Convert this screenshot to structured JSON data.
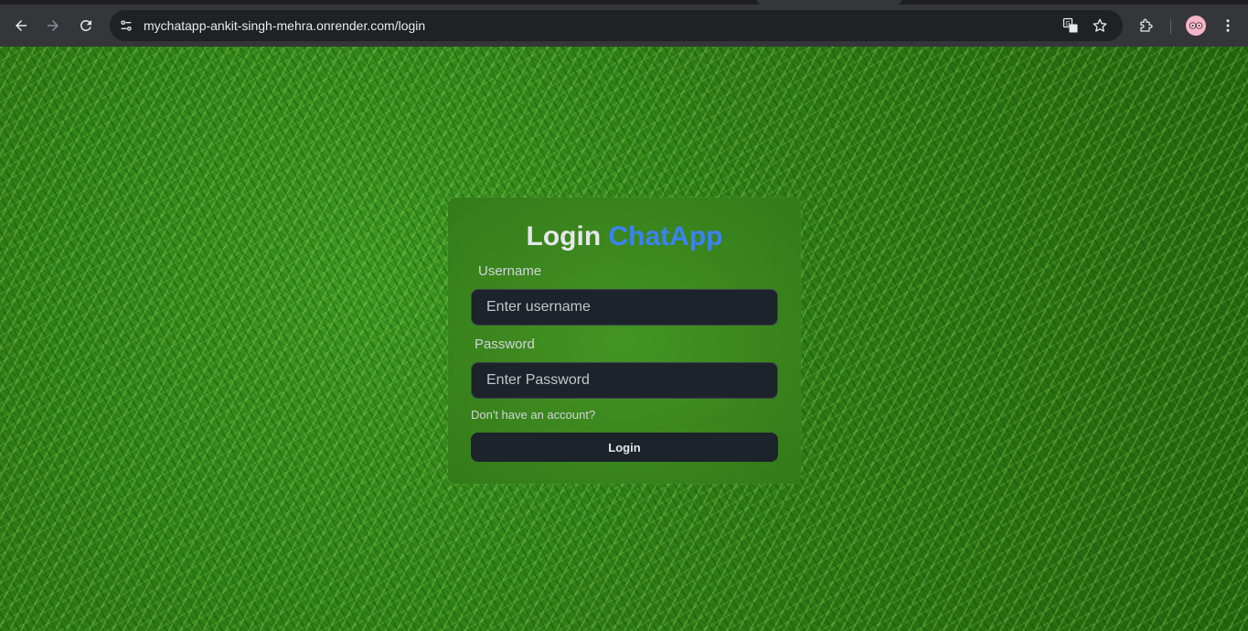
{
  "browser": {
    "url": "mychatapp-ankit-singh-mehra.onrender.com/login",
    "icons": {
      "back": "back-arrow-icon",
      "forward": "forward-arrow-icon",
      "reload": "reload-icon",
      "site_info": "site-info-icon",
      "translate": "translate-icon",
      "bookmark": "star-icon",
      "extensions": "puzzle-icon",
      "profile": "avatar",
      "menu": "kebab-menu-icon"
    }
  },
  "login": {
    "title_prefix": "Login",
    "title_brand": "ChatApp",
    "username_label": "Username",
    "username_placeholder": "Enter username",
    "password_label": "Password",
    "password_placeholder": "Enter Password",
    "signup_link": "Don't have an account?",
    "submit_label": "Login"
  },
  "colors": {
    "brand_accent": "#3b82f6",
    "input_bg": "#1d232a",
    "card_tint": "#3c8c1e",
    "chrome_toolbar": "#35363a",
    "omnibox_bg": "#202124"
  }
}
